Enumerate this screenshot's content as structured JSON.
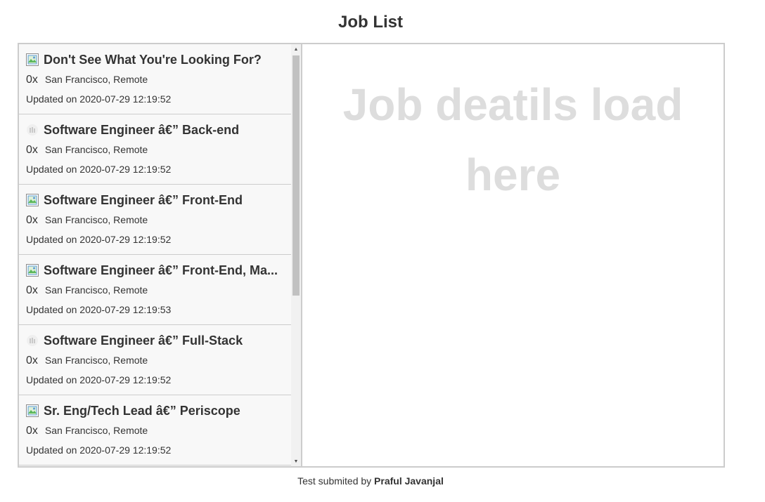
{
  "page": {
    "title": "Job List"
  },
  "jobs": [
    {
      "title": "Don't See What You're Looking For?",
      "salary": "0x",
      "location": "San Francisco, Remote",
      "updated": "Updated on 2020-07-29 12:19:52",
      "logo_icon": "broken-image-icon"
    },
    {
      "title": "Software Engineer â€” Back-end",
      "salary": "0x",
      "location": "San Francisco, Remote",
      "updated": "Updated on 2020-07-29 12:19:52",
      "logo_icon": "bar-logo-icon"
    },
    {
      "title": "Software Engineer â€” Front-End",
      "salary": "0x",
      "location": "San Francisco, Remote",
      "updated": "Updated on 2020-07-29 12:19:52",
      "logo_icon": "broken-image-icon"
    },
    {
      "title": "Software Engineer â€” Front-End, Ma...",
      "salary": "0x",
      "location": "San Francisco, Remote",
      "updated": "Updated on 2020-07-29 12:19:53",
      "logo_icon": "broken-image-icon"
    },
    {
      "title": "Software Engineer â€” Full-Stack",
      "salary": "0x",
      "location": "San Francisco, Remote",
      "updated": "Updated on 2020-07-29 12:19:52",
      "logo_icon": "bar-logo-icon"
    },
    {
      "title": "Sr. Eng/Tech Lead â€” Periscope",
      "salary": "0x",
      "location": "San Francisco, Remote",
      "updated": "Updated on 2020-07-29 12:19:52",
      "logo_icon": "broken-image-icon"
    }
  ],
  "details": {
    "placeholder": "Job deatils load here"
  },
  "footer": {
    "prefix": "Test submited by ",
    "author": "Praful Javanjal"
  },
  "colors": {
    "border": "#cccccc",
    "list_background": "#f8f8f8",
    "placeholder_text": "#dddddd",
    "scroll_thumb": "#c1c1c1"
  }
}
